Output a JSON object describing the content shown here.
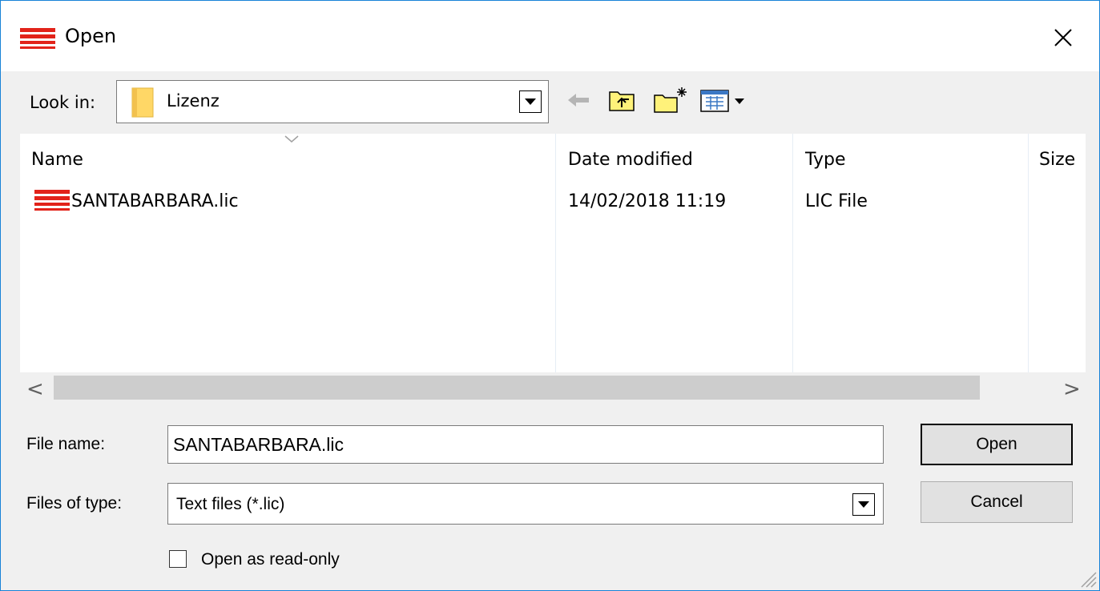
{
  "window": {
    "title": "Open"
  },
  "icons": {
    "app": "red-stripes-icon",
    "close": "close-icon",
    "folder": "folder-icon",
    "back": "back-arrow-icon",
    "up_folder": "up-folder-icon",
    "new_folder": "new-folder-icon",
    "view_menu": "view-menu-icon"
  },
  "look_in": {
    "label": "Look in:",
    "value": "Lizenz"
  },
  "file_list": {
    "columns": [
      "Name",
      "Date modified",
      "Type",
      "Size"
    ],
    "rows": [
      {
        "name": "SANTABARBARA.lic",
        "date_modified": "14/02/2018 11:19",
        "type": "LIC File",
        "size": ""
      }
    ]
  },
  "scrollbar": {
    "left_arrow": "<",
    "right_arrow": ">"
  },
  "file_name": {
    "label": "File name:",
    "value": "SANTABARBARA.lic"
  },
  "files_of_type": {
    "label": "Files of type:",
    "value": "Text files (*.lic)"
  },
  "buttons": {
    "open": "Open",
    "cancel": "Cancel"
  },
  "read_only": {
    "label": "Open as read-only",
    "checked": false
  },
  "colors": {
    "accent_border": "#1883d7",
    "icon_red": "#e2231a",
    "folder_yellow": "#ffd766"
  }
}
